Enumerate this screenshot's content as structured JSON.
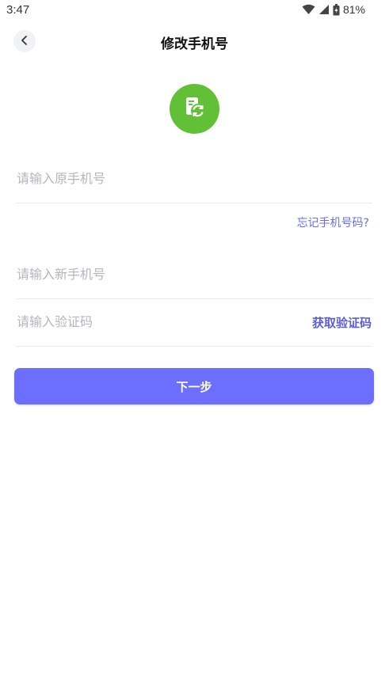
{
  "status_bar": {
    "time": "3:47",
    "battery": "81%",
    "icons": [
      "wifi-icon",
      "cellular-signal-icon",
      "battery-icon"
    ]
  },
  "header": {
    "title": "修改手机号",
    "back_icon": "chevron-left-icon"
  },
  "logo": {
    "icon": "phone-sync-icon",
    "color": "#62c036"
  },
  "form": {
    "old_phone_placeholder": "请输入原手机号",
    "old_phone_value": "",
    "forgot_link": "忘记手机号码?",
    "new_phone_placeholder": "请输入新手机号",
    "new_phone_value": "",
    "code_placeholder": "请输入验证码",
    "code_value": "",
    "get_code_label": "获取验证码"
  },
  "next_button": {
    "label": "下一步",
    "color": "#6c6ffe"
  },
  "colors": {
    "accent": "#6a6cf6",
    "placeholder": "#b5b5bd",
    "divider": "#e9e9ef"
  }
}
